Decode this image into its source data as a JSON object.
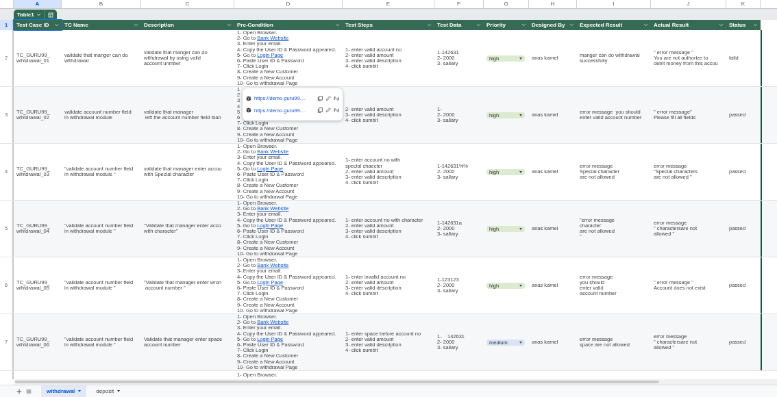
{
  "column_letters": [
    {
      "label": "A",
      "selected": true
    },
    {
      "label": "B",
      "selected": false
    },
    {
      "label": "C",
      "selected": false
    },
    {
      "label": "D",
      "selected": false
    },
    {
      "label": "E",
      "selected": false
    },
    {
      "label": "F",
      "selected": false
    },
    {
      "label": "G",
      "selected": false
    },
    {
      "label": "H",
      "selected": false
    },
    {
      "label": "I",
      "selected": false
    },
    {
      "label": "J",
      "selected": false
    },
    {
      "label": "K",
      "selected": false
    }
  ],
  "table_tab": {
    "label": "Table1"
  },
  "header_row": {
    "number": "1",
    "selected": true
  },
  "columns": [
    "Test Case ID",
    "TC Name",
    "Description",
    "Pre-Condition",
    "Test Steps",
    "Test Data",
    "Priority",
    "Designed By",
    "Expected Result",
    "Actual Result",
    "Status"
  ],
  "rows": [
    {
      "number": "2",
      "id": "TC_GURU99_\nwihtdrawal_01",
      "name": "validate that manger can do\nwithdrawal",
      "description": "validate that manger can do\nwithdrawal by using valid\naccount unmber",
      "precondition": [
        "1- Open Browser.",
        {
          "text": "2- Go to ",
          "link": "Bank Website"
        },
        "3- Enter your email.",
        "4- Copy the User ID & Password appeared.",
        {
          "text": "5- Go to ",
          "link": "Login Page"
        },
        "6- Paste User ID & Password",
        "7- Click Login",
        "8- Create a New Customer",
        "9- Create a New Account",
        "10- Go to withdrawal Page"
      ],
      "steps": "1- enter valid account no\n2- enter valid amount\n3- enter valid description\n4- click sumbit",
      "test_data": "1-142631\n2- 2000\n3- sallary",
      "priority": {
        "label": "high",
        "color": "#dcebd0"
      },
      "designed_by": "anas kamel",
      "expected": "manger can do withdrawal\nsuccessfully",
      "actual": "\" error message \"\nYou are not authorize to\ndebit money from this accou",
      "status": "faild"
    },
    {
      "number": "3",
      "id": "TC_GURU99_\nwihtdrawal_02",
      "name": "validate account number field\nin withdrawal module",
      "description": "validate that manager\n left the account number field blan",
      "precondition": [
        "1",
        "2",
        "3",
        "4",
        "5",
        "6",
        "7- Click Login",
        "8- Create a New Customer",
        "9- Create a New Account",
        "10- Go to withdrawal Page"
      ],
      "steps": "2- enter valid amount\n3- enter valid description\n4- click sumbit",
      "test_data": "1-\n2- 2000\n3- sallary",
      "priority": {
        "label": "high",
        "color": "#dcebd0"
      },
      "designed_by": "anas kamel",
      "expected": "error message  you should\nenter valid account number",
      "actual": "\" error message\"\nPlease fill all fields",
      "status": "passed"
    },
    {
      "number": "4",
      "id": "TC_GURU99_\nwihtdrawal_03",
      "name": "\"validate account number field\nin withdrawal module \"",
      "description": "validate that manager enter accou\nwith Special character",
      "precondition": [
        "1- Open Browser.",
        {
          "text": "2- Go to ",
          "link": "Bank Website"
        },
        "3- Enter your email.",
        "4- Copy the User ID & Password appeared.",
        {
          "text": "5- Go to ",
          "link": "Login Page"
        },
        "6- Paste User ID & Password",
        "7- Click Login",
        "8- Create a New Customer",
        "9- Create a New Account",
        "10- Go to withdrawal Page"
      ],
      "steps": "1- enter account no with\nspecial chaecter\n2- enter valid amount\n3- enter valid description\n4- click sumbit",
      "test_data": "1-142631%%\n2- 2000\n3- sallary",
      "priority": {
        "label": "high",
        "color": "#dcebd0"
      },
      "designed_by": "anas kamel",
      "expected": "error message\nSpecial character\nare not allowed",
      "actual": "error message\n\"Special characters\nare not allowed \"",
      "status": "passed"
    },
    {
      "number": "5",
      "id": "TC_GURU99_\nwihtdrawal_04",
      "name": "\"validate account number field\nin withdrawal module \"",
      "description": "\"Validate that manager enter acco\nwith character\"",
      "precondition": [
        "1- Open Browser.",
        {
          "text": "2- Go to ",
          "link": "Bank Website"
        },
        "3- Enter your email.",
        "4- Copy the User ID & Password appeared.",
        {
          "text": "5- Go to ",
          "link": "Login Page"
        },
        "6- Paste User ID & Password",
        "7- Click Login",
        "8- Create a New Customer",
        "9- Create a New Account",
        "10- Go to withdrawal Page"
      ],
      "steps": "1- enter account no with character\n2- enter valid amount\n3- enter valid description\n4- click sumbit",
      "test_data": "1-142631a\n2- 2000\n3- sallary",
      "priority": {
        "label": "high",
        "color": "#dcebd0"
      },
      "designed_by": "anas kamel",
      "expected": "\"error message\ncharacter\nare not allowed\n\"",
      "actual": "error message\n\" charactersare not\nallowed \"",
      "status": "passed"
    },
    {
      "number": "6",
      "id": "TC_GURU99_\nwihtdrawal_05",
      "name": "\"validate account number field\nin withdrawal module \"",
      "description": "\"Validate that manager enter wron\n account number \"",
      "precondition": [
        "1- Open Browser.",
        {
          "text": "2- Go to ",
          "link": "Bank Website"
        },
        "3- Enter your email.",
        "4- Copy the User ID & Password appeared.",
        {
          "text": "5- Go to ",
          "link": "Login Page"
        },
        "6- Paste User ID & Password",
        "7- Click Login",
        "8- Create a New Customer",
        "9- Create a New Account",
        "10- Go to withdrawal Page"
      ],
      "steps": "1- enter invalid account no\n2- enter valid amount\n3- enter valid description\n4- click sumbit",
      "test_data": "1-123123\n2- 2000\n3- sallary",
      "priority": {
        "label": "high",
        "color": "#dcebd0"
      },
      "designed_by": "anas kamel",
      "expected": "error message\nyou should\nenter valid\naccount number",
      "actual": "\" error message \"\nAccount does not exist",
      "status": "passed"
    },
    {
      "number": "7",
      "id": "TC_GURU99_\nwihtdrawal_06",
      "name": "\"validate account number field\nin withdrawal module \"",
      "description": "Validate that manager enter space\naccount number",
      "precondition": [
        "1- Open Browser.",
        {
          "text": "2- Go to ",
          "link": "Bank Website"
        },
        "3- Enter your email.",
        "4- Copy the User ID & Password appeared.",
        {
          "text": "5- Go to ",
          "link": "Login Page"
        },
        "6- Paste User ID & Password",
        "7- Click Login",
        "8- Create a New Customer",
        "9- Create a New Account",
        "10- Go to withdrawal Page"
      ],
      "steps": "1- enter space before account no\n2- enter valid amount\n3- enter valid description\n4- click sumbit",
      "test_data": "1-    142631\n2- 2000\n3- sallary",
      "priority": {
        "label": "medium",
        "color": "#d7e4f5"
      },
      "designed_by": "anas kamel",
      "expected": "error message\nspace are not allowed",
      "actual": "error message\n\" charactersare not\nallowed \"",
      "status": "passed"
    }
  ],
  "partial_row": {
    "precondition": "1- Open Browser."
  },
  "link_popup": {
    "links": [
      "https://demo.guru99....",
      "https://demo.guru99...."
    ]
  },
  "sheet_tabs": [
    {
      "label": "withdrawal",
      "selected": true
    },
    {
      "label": "deposit",
      "selected": false
    }
  ]
}
